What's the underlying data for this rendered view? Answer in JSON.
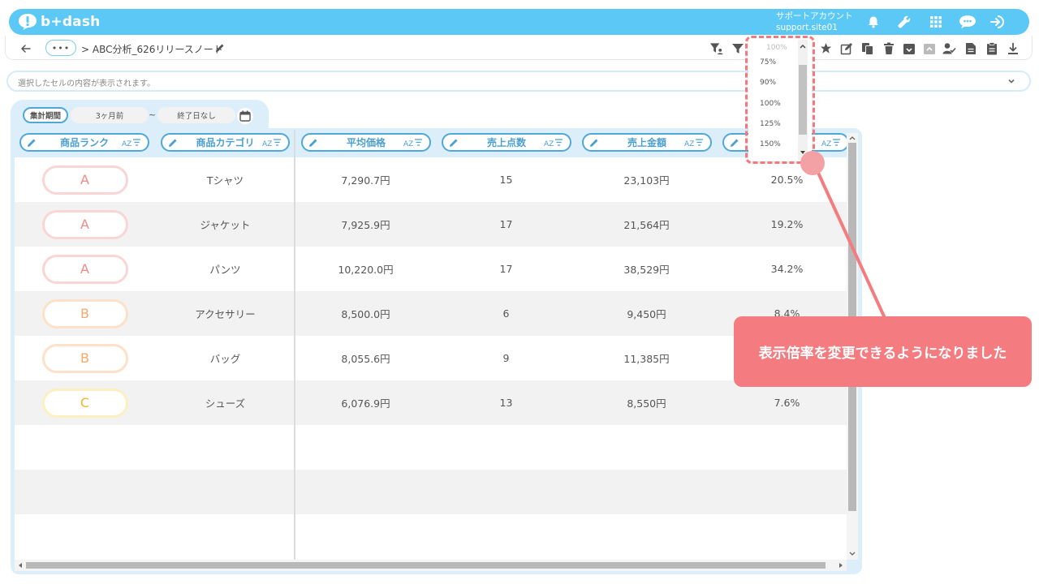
{
  "app": {
    "logo_text": "b+dash",
    "account_name": "サポートアカウント",
    "account_site": "support.site01"
  },
  "toolbar": {
    "more_label": "•••",
    "breadcrumb": "> ABC分析_626リリースノート"
  },
  "cellbar": {
    "placeholder": "選択したセルの内容が表示されます。"
  },
  "period": {
    "label": "集計期間",
    "start": "3ヶ月前",
    "separator": "~",
    "end": "終了日なし"
  },
  "columns": [
    {
      "label": "商品ランク"
    },
    {
      "label": "商品カテゴリ"
    },
    {
      "label": "平均価格"
    },
    {
      "label": "売上点数"
    },
    {
      "label": "売上金額"
    },
    {
      "label": ""
    }
  ],
  "rows": [
    {
      "rank": "A",
      "category": "Tシャツ",
      "avg_price": "7,290.7円",
      "qty": "15",
      "sales": "23,103円",
      "ratio": "20.5%"
    },
    {
      "rank": "A",
      "category": "ジャケット",
      "avg_price": "7,925.9円",
      "qty": "17",
      "sales": "21,564円",
      "ratio": "19.2%"
    },
    {
      "rank": "A",
      "category": "パンツ",
      "avg_price": "10,220.0円",
      "qty": "17",
      "sales": "38,529円",
      "ratio": "34.2%"
    },
    {
      "rank": "B",
      "category": "アクセサリー",
      "avg_price": "8,500.0円",
      "qty": "6",
      "sales": "9,450円",
      "ratio": "8.4%"
    },
    {
      "rank": "B",
      "category": "バッグ",
      "avg_price": "8,055.6円",
      "qty": "9",
      "sales": "11,385円",
      "ratio": ""
    },
    {
      "rank": "C",
      "category": "シューズ",
      "avg_price": "6,076.9円",
      "qty": "13",
      "sales": "8,550円",
      "ratio": "7.6%"
    }
  ],
  "zoom": {
    "current": "100%",
    "options": [
      "75%",
      "90%",
      "100%",
      "125%",
      "150%"
    ]
  },
  "callout": {
    "text": "表示倍率を変更できるようになりました"
  },
  "colors": {
    "header": "#5bc8f5",
    "accent": "#4fa8d8",
    "rank_a": "#f08a8a",
    "rank_b": "#f5a86a",
    "rank_c": "#f2b33a",
    "callout": "#f47c80"
  }
}
